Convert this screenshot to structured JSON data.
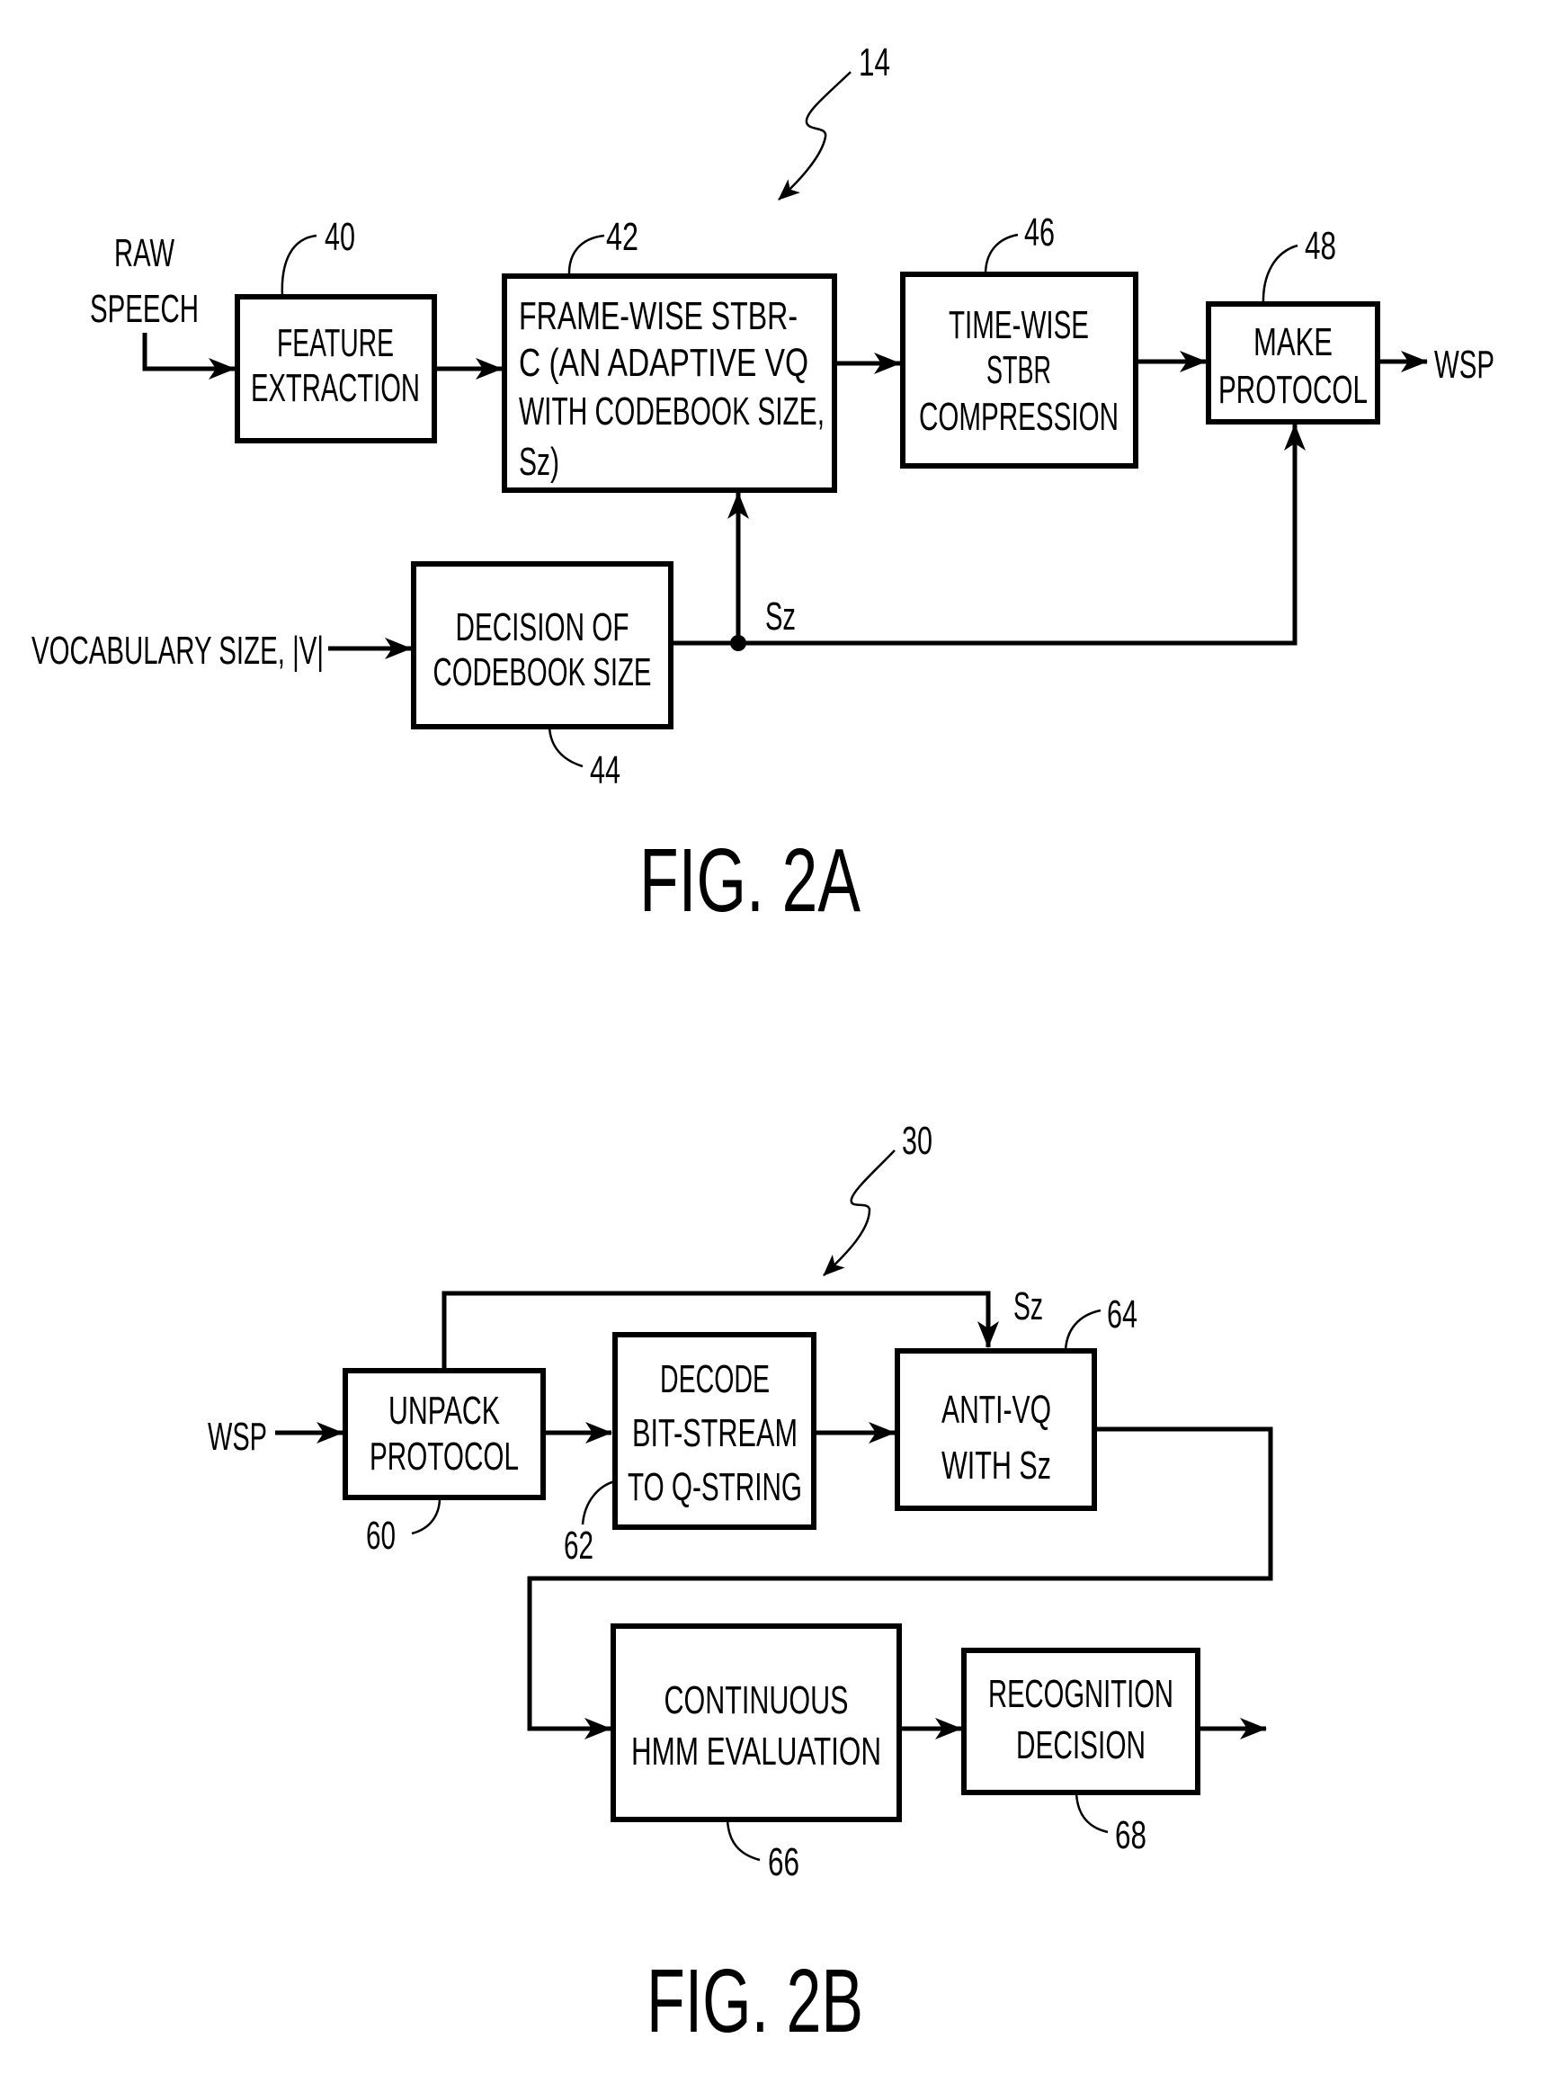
{
  "figures": [
    {
      "caption": "FIG. 2A",
      "reference": "14",
      "inputs": {
        "raw_speech": [
          "RAW",
          "SPEECH"
        ],
        "vocabulary": "VOCABULARY SIZE, |V|"
      },
      "output": "WSP",
      "signal_label": "Sz",
      "blocks": [
        {
          "id": "40",
          "lines": [
            "FEATURE",
            "EXTRACTION"
          ]
        },
        {
          "id": "42",
          "lines": [
            "FRAME-WISE STBR-",
            "C (AN ADAPTIVE VQ",
            "WITH CODEBOOK SIZE,",
            "Sz)"
          ]
        },
        {
          "id": "46",
          "lines": [
            "TIME-WISE",
            "STBR",
            "COMPRESSION"
          ]
        },
        {
          "id": "48",
          "lines": [
            "MAKE",
            "PROTOCOL"
          ]
        },
        {
          "id": "44",
          "lines": [
            "DECISION OF",
            "CODEBOOK SIZE"
          ]
        }
      ]
    },
    {
      "caption": "FIG. 2B",
      "reference": "30",
      "input": "WSP",
      "signal_label": "Sz",
      "blocks": [
        {
          "id": "60",
          "lines": [
            "UNPACK",
            "PROTOCOL"
          ]
        },
        {
          "id": "62",
          "lines": [
            "DECODE",
            "BIT-STREAM",
            "TO Q-STRING"
          ]
        },
        {
          "id": "64",
          "lines": [
            "ANTI-VQ",
            "WITH Sz"
          ]
        },
        {
          "id": "66",
          "lines": [
            "CONTINUOUS",
            "HMM EVALUATION"
          ]
        },
        {
          "id": "68",
          "lines": [
            "RECOGNITION",
            "DECISION"
          ]
        }
      ]
    }
  ]
}
